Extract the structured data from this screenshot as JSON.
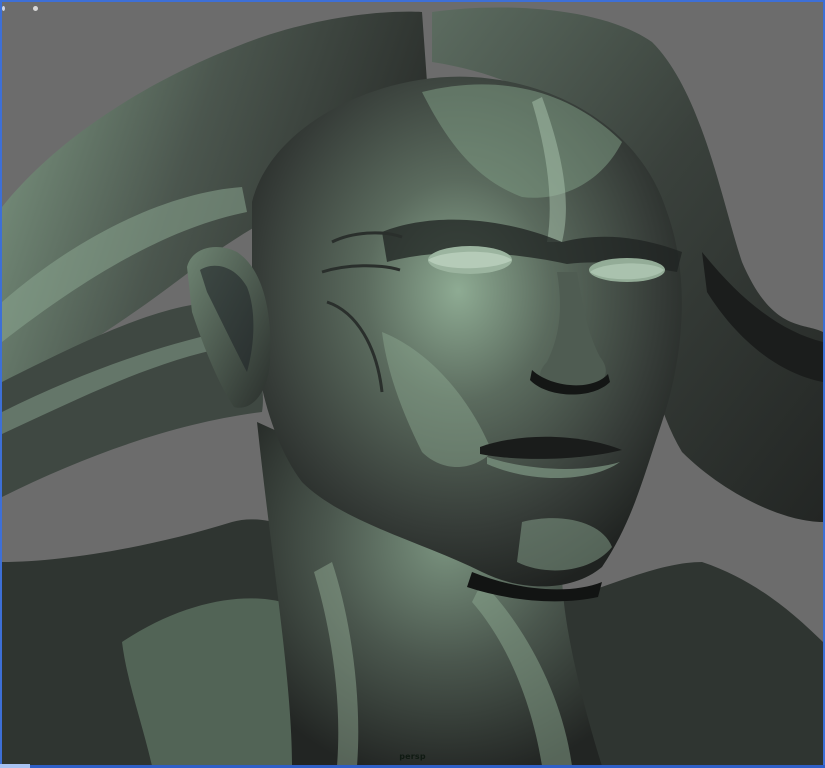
{
  "viewport": {
    "camera_label": "persp"
  },
  "icons": {
    "corner_left": "viewport-marker-icon",
    "corner_right": "dot-icon"
  },
  "colors": {
    "background": "#6c6c6c",
    "active_border": "#3d6fd6",
    "skin_highlight": "#8fb196",
    "skin_shadow": "#1e211f"
  }
}
